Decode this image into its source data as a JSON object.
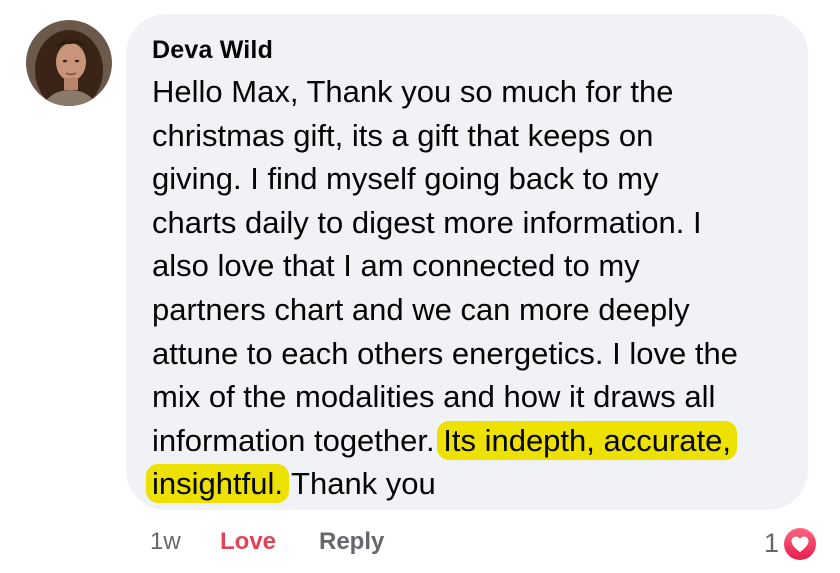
{
  "comment": {
    "author": "Deva Wild",
    "lines": [
      "Hello Max, Thank you so much for the",
      "christmas gift, its a gift that keeps on",
      "giving. I find myself going back to my",
      "charts daily to digest more information. I",
      "also love that I am connected to my",
      "partners chart and we can more deeply",
      "attune to each others energetics. I love the",
      "mix of the modalities and how it draws all"
    ],
    "line9_plain": "information together. ",
    "line9_highlight": "Its indepth, accurate,",
    "line10_highlight": "insightful.",
    "line10_plain": " Thank you",
    "highlight_color": "#ece100"
  },
  "actions": {
    "time": "1w",
    "love_label": "Love",
    "reply_label": "Reply",
    "love_color": "#e14357"
  },
  "reactions": {
    "count": "1",
    "icon": "heart-icon"
  }
}
